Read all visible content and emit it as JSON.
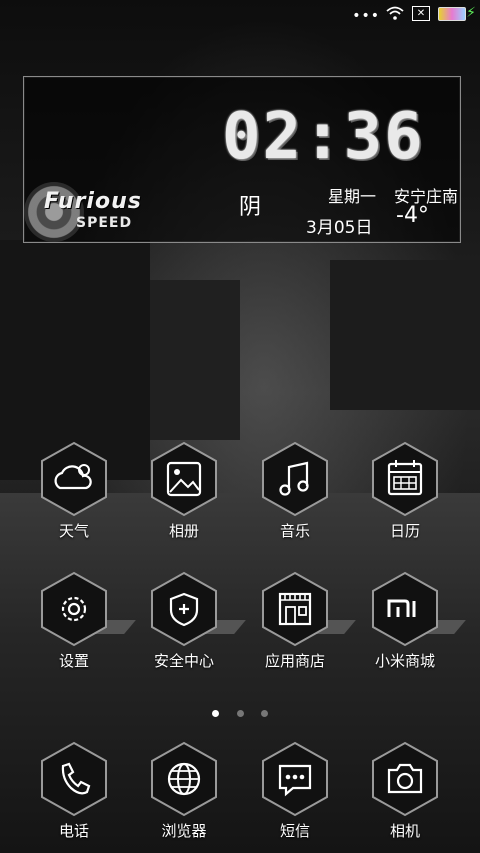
{
  "status_bar": {
    "dots": "•••",
    "sim": "✕"
  },
  "widget": {
    "time": "02:36",
    "weather_condition": "阴",
    "weekday": "星期一",
    "date": "3月05日",
    "city": "安宁庄南",
    "temperature": "-4°",
    "logo_line1": "Furious",
    "logo_line2": "SPEED"
  },
  "apps_row1": [
    {
      "label": "天气",
      "icon": "weather-icon"
    },
    {
      "label": "相册",
      "icon": "gallery-icon"
    },
    {
      "label": "音乐",
      "icon": "music-icon"
    },
    {
      "label": "日历",
      "icon": "calendar-icon"
    }
  ],
  "apps_row2": [
    {
      "label": "设置",
      "icon": "settings-icon"
    },
    {
      "label": "安全中心",
      "icon": "security-icon"
    },
    {
      "label": "应用商店",
      "icon": "store-icon"
    },
    {
      "label": "小米商城",
      "icon": "mi-icon"
    }
  ],
  "dock": [
    {
      "label": "电话",
      "icon": "phone-icon"
    },
    {
      "label": "浏览器",
      "icon": "browser-icon"
    },
    {
      "label": "短信",
      "icon": "message-icon"
    },
    {
      "label": "相机",
      "icon": "camera-icon"
    }
  ],
  "pager": {
    "total": 3,
    "current": 1
  },
  "colors": {
    "accent": "#ffffff",
    "battery_charge": "#5ff05a"
  }
}
